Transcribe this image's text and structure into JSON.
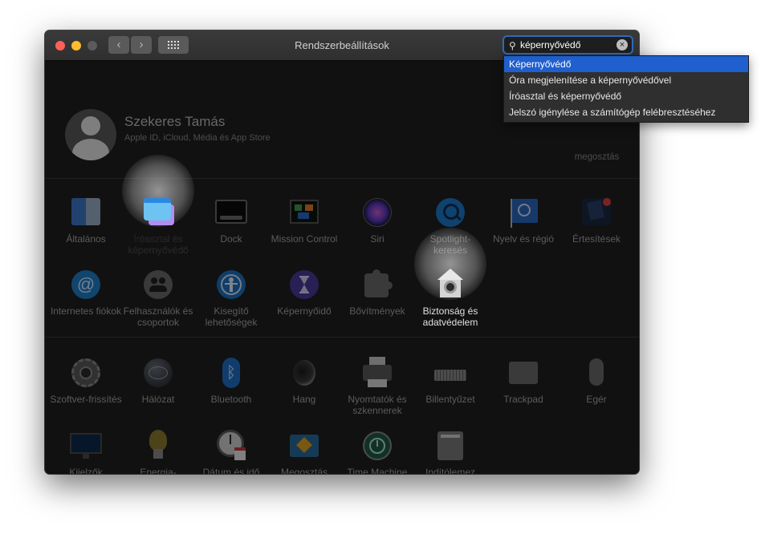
{
  "window": {
    "title": "Rendszerbeállítások"
  },
  "search": {
    "query": "képernyővédő"
  },
  "suggestions": [
    "Képernyővédő",
    "Óra megjelenítése a képernyővédővel",
    "Íróasztal és képernyővédő",
    "Jelszó igénylése a számítógép felébresztéséhez"
  ],
  "account": {
    "name": "Szekeres Tamás",
    "subtitle": "Apple ID, iCloud, Média és App Store",
    "share_partial": "megosztás"
  },
  "row1": [
    {
      "label": "Általános",
      "icon": "general-icon"
    },
    {
      "label": "Íróasztal és képernyővédő",
      "icon": "desktop-screensaver-icon"
    },
    {
      "label": "Dock",
      "icon": "dock-icon"
    },
    {
      "label": "Mission Control",
      "icon": "mission-control-icon"
    },
    {
      "label": "Siri",
      "icon": "siri-icon"
    },
    {
      "label": "Spotlight-keresés",
      "icon": "spotlight-icon"
    },
    {
      "label": "Nyelv és régió",
      "icon": "language-region-icon"
    },
    {
      "label": "Értesítések",
      "icon": "notifications-icon"
    }
  ],
  "row2": [
    {
      "label": "Internetes fiókok",
      "icon": "internet-accounts-icon"
    },
    {
      "label": "Felhasználók és csoportok",
      "icon": "users-groups-icon"
    },
    {
      "label": "Kisegítő lehetőségek",
      "icon": "accessibility-icon"
    },
    {
      "label": "Képernyőidő",
      "icon": "screen-time-icon"
    },
    {
      "label": "Bővítmények",
      "icon": "extensions-icon"
    },
    {
      "label": "Biztonság és adatvédelem",
      "icon": "security-privacy-icon"
    }
  ],
  "row3": [
    {
      "label": "Szoftver-frissítés",
      "icon": "software-update-icon"
    },
    {
      "label": "Hálózat",
      "icon": "network-icon"
    },
    {
      "label": "Bluetooth",
      "icon": "bluetooth-icon"
    },
    {
      "label": "Hang",
      "icon": "sound-icon"
    },
    {
      "label": "Nyomtatók és szkennerek",
      "icon": "printers-scanners-icon"
    },
    {
      "label": "Billentyűzet",
      "icon": "keyboard-icon"
    },
    {
      "label": "Trackpad",
      "icon": "trackpad-icon"
    },
    {
      "label": "Egér",
      "icon": "mouse-icon"
    }
  ],
  "row4": [
    {
      "label": "Kijelzők",
      "icon": "displays-icon"
    },
    {
      "label": "Energia-takarékosság",
      "icon": "energy-saver-icon"
    },
    {
      "label": "Dátum és idő",
      "icon": "date-time-icon"
    },
    {
      "label": "Megosztás",
      "icon": "sharing-icon"
    },
    {
      "label": "Time Machine",
      "icon": "time-machine-icon"
    },
    {
      "label": "Indítólemez",
      "icon": "startup-disk-icon"
    }
  ],
  "highlighted": [
    "Íróasztal és képernyővédő",
    "Biztonság és adatvédelem"
  ]
}
